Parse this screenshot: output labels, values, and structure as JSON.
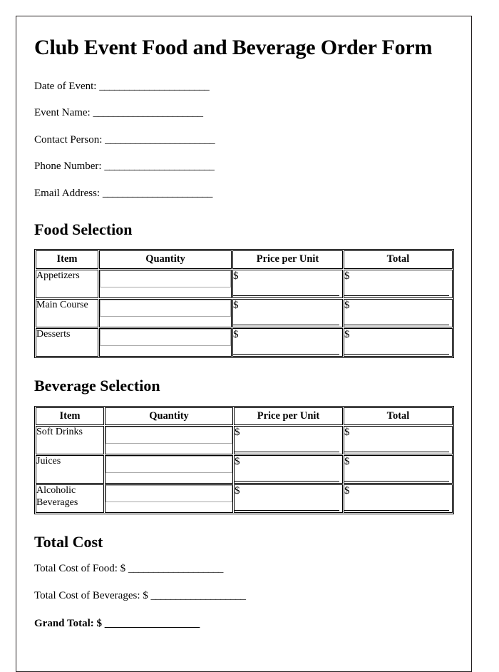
{
  "document": {
    "title": "Club Event Food and Beverage Order Form",
    "blank_line": "______________________",
    "blank_line_long": "___________________",
    "currency_symbol": "$"
  },
  "header_fields": [
    {
      "label": "Date of Event:",
      "blank": "______________________",
      "value": ""
    },
    {
      "label": "Event Name:",
      "blank": "______________________",
      "value": ""
    },
    {
      "label": "Contact Person:",
      "blank": "______________________",
      "value": ""
    },
    {
      "label": "Phone Number:",
      "blank": "______________________",
      "value": ""
    },
    {
      "label": "Email Address:",
      "blank": "______________________",
      "value": ""
    }
  ],
  "food_section": {
    "heading": "Food Selection",
    "columns": [
      "Item",
      "Quantity",
      "Price per Unit",
      "Total"
    ],
    "rows": [
      {
        "item": "Appetizers",
        "quantity": "",
        "price_symbol": "$",
        "price": "",
        "total_symbol": "$",
        "total": ""
      },
      {
        "item": "Main Course",
        "quantity": "",
        "price_symbol": "$",
        "price": "",
        "total_symbol": "$",
        "total": ""
      },
      {
        "item": "Desserts",
        "quantity": "",
        "price_symbol": "$",
        "price": "",
        "total_symbol": "$",
        "total": ""
      }
    ]
  },
  "beverage_section": {
    "heading": "Beverage Selection",
    "columns": [
      "Item",
      "Quantity",
      "Price per Unit",
      "Total"
    ],
    "rows": [
      {
        "item": "Soft Drinks",
        "quantity": "",
        "price_symbol": "$",
        "price": "",
        "total_symbol": "$",
        "total": ""
      },
      {
        "item": "Juices",
        "quantity": "",
        "price_symbol": "$",
        "price": "",
        "total_symbol": "$",
        "total": ""
      },
      {
        "item": "Alcoholic Beverages",
        "quantity": "",
        "price_symbol": "$",
        "price": "",
        "total_symbol": "$",
        "total": ""
      }
    ]
  },
  "total_section": {
    "heading": "Total Cost",
    "rows": [
      {
        "label": "Total Cost of Food: $",
        "blank": "___________________",
        "bold": false
      },
      {
        "label": "Total Cost of Beverages: $",
        "blank": "___________________",
        "bold": false
      },
      {
        "label": "Grand Total: $",
        "blank": "___________________",
        "bold": true
      }
    ]
  }
}
